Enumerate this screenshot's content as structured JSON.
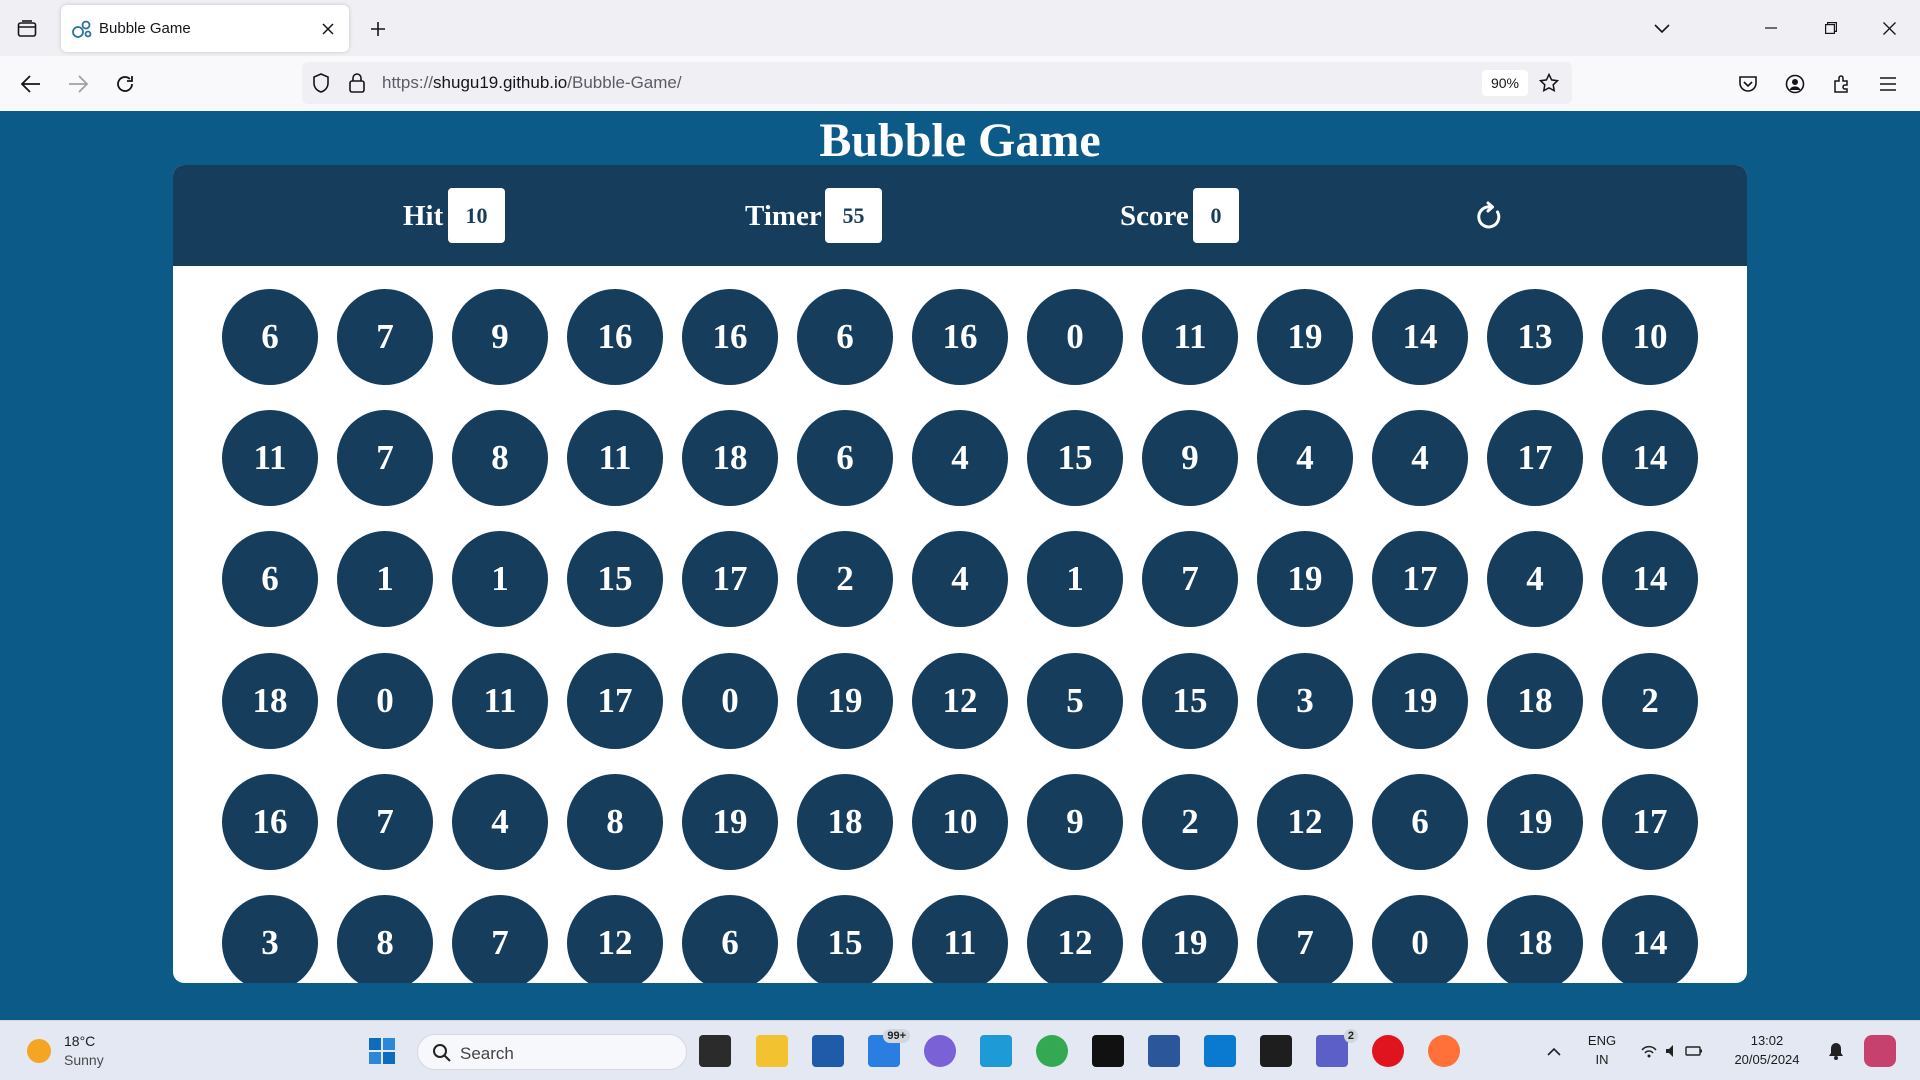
{
  "browser": {
    "tab_title": "Bubble Game",
    "url_prefix": "https://",
    "url_host": "shugu19.github.io",
    "url_path": "/Bubble-Game/",
    "zoom": "90%"
  },
  "game": {
    "title": "Bubble Game",
    "hit_label": "Hit",
    "hit_value": "10",
    "timer_label": "Timer",
    "timer_value": "55",
    "score_label": "Score",
    "score_value": "0",
    "bubbles": [
      [
        6,
        7,
        9,
        16,
        16,
        6,
        16,
        0,
        11,
        19,
        14,
        13,
        10
      ],
      [
        11,
        7,
        8,
        11,
        18,
        6,
        4,
        15,
        9,
        4,
        4,
        17,
        14
      ],
      [
        6,
        1,
        1,
        15,
        17,
        2,
        4,
        1,
        7,
        19,
        17,
        4,
        14
      ],
      [
        18,
        0,
        11,
        17,
        0,
        19,
        12,
        5,
        15,
        3,
        19,
        18,
        2
      ],
      [
        16,
        7,
        4,
        8,
        19,
        18,
        10,
        9,
        2,
        12,
        6,
        19,
        17
      ],
      [
        3,
        8,
        7,
        12,
        6,
        15,
        11,
        12,
        19,
        7,
        0,
        18,
        14
      ]
    ]
  },
  "taskbar": {
    "weather_temp": "18°C",
    "weather_desc": "Sunny",
    "search_label": "Search",
    "mail_badge": "99+",
    "teams_badge": "2",
    "lang_top": "ENG",
    "lang_bottom": "IN",
    "time": "13:02",
    "date": "20/05/2024"
  },
  "colors": {
    "page_bg": "#0c5a87",
    "panel_bg": "#163d5c",
    "bubble_bg": "#163d5c"
  }
}
